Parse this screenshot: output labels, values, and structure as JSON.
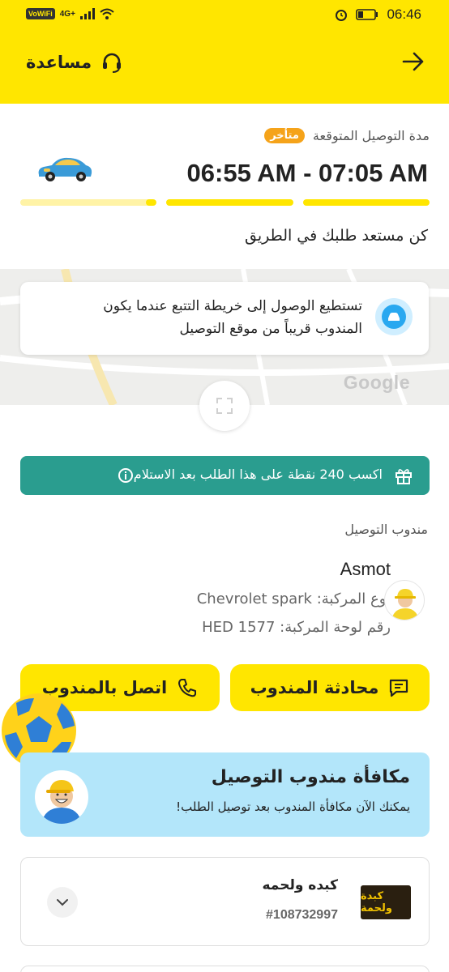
{
  "status_bar": {
    "vowifi": "VoWiFi",
    "network": "4G+",
    "time": "06:46"
  },
  "header": {
    "help_label": "مساعدة"
  },
  "delivery": {
    "eta_label": "مدة التوصيل المتوقعة",
    "late_badge": "متأخر",
    "eta_range": "06:55 AM - 07:05 AM",
    "progress": [
      1,
      1,
      0.08
    ],
    "status_text": "كن مستعد طلبك في الطريق"
  },
  "map": {
    "info_text": "تستطيع الوصول إلى خريطة التتبع عندما يكون المندوب قريباً من موقع التوصيل",
    "watermark": "Google"
  },
  "points_banner": {
    "text": "اكسب 240 نقطة على هذا الطلب بعد الاستلام"
  },
  "driver": {
    "section_title": "مندوب التوصيل",
    "name": "Asmot",
    "vehicle_type": "نوع المركبة: Chevrolet spark",
    "plate": "رقم لوحة المركبة: HED 1577"
  },
  "actions": {
    "chat_label": "محادثة المندوب",
    "call_label": "اتصل بالمندوب"
  },
  "reward": {
    "title": "مكافأة مندوب التوصيل",
    "subtitle": "يمكنك الآن مكافأة المندوب بعد توصيل الطلب!"
  },
  "order": {
    "restaurant": "كبده ولحمه",
    "number": "#108732997",
    "logo_text": "كبدة ولحمة"
  },
  "colors": {
    "accent": "#ffe600",
    "teal": "#2a9d8f",
    "late": "#f5a31a",
    "reward_bg": "#b3e6fa"
  }
}
